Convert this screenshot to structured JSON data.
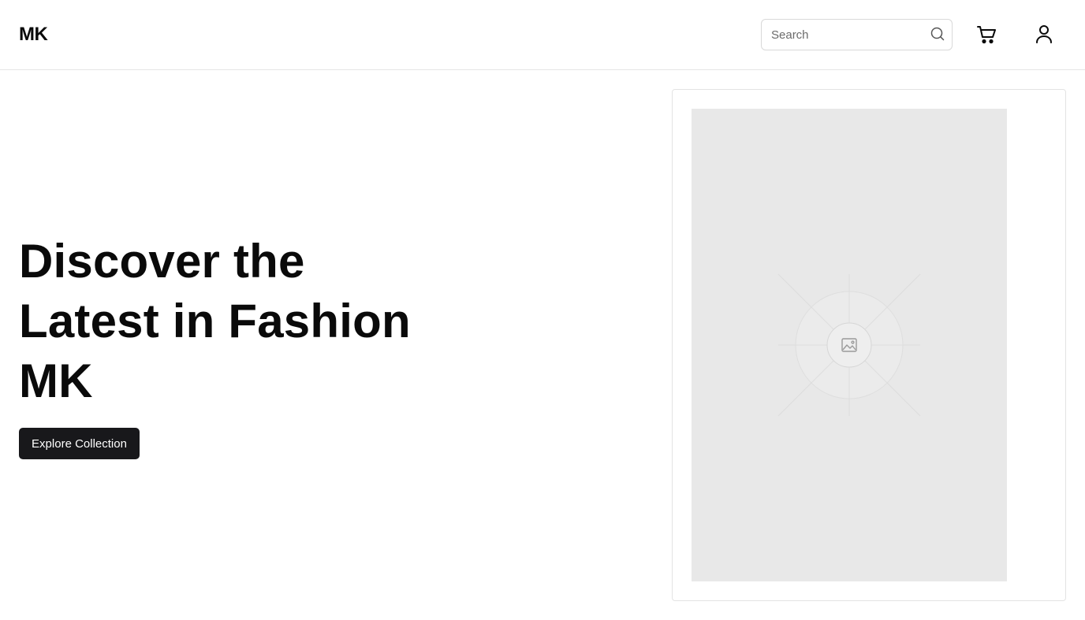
{
  "header": {
    "logo": "MK",
    "search": {
      "placeholder": "Search",
      "value": ""
    },
    "icons": {
      "search": "search-icon",
      "cart": "cart-icon",
      "account": "user-icon"
    }
  },
  "hero": {
    "title_lines": [
      "Discover the",
      "Latest in Fashion",
      "MK"
    ],
    "cta_label": "Explore Collection"
  },
  "product_card": {
    "image_icon": "image-placeholder-icon"
  },
  "colors": {
    "text": "#0a0a0a",
    "button_bg": "#18181b",
    "button_text": "#ffffff",
    "placeholder_bg": "#e8e8e8",
    "border": "#e5e5e5"
  }
}
